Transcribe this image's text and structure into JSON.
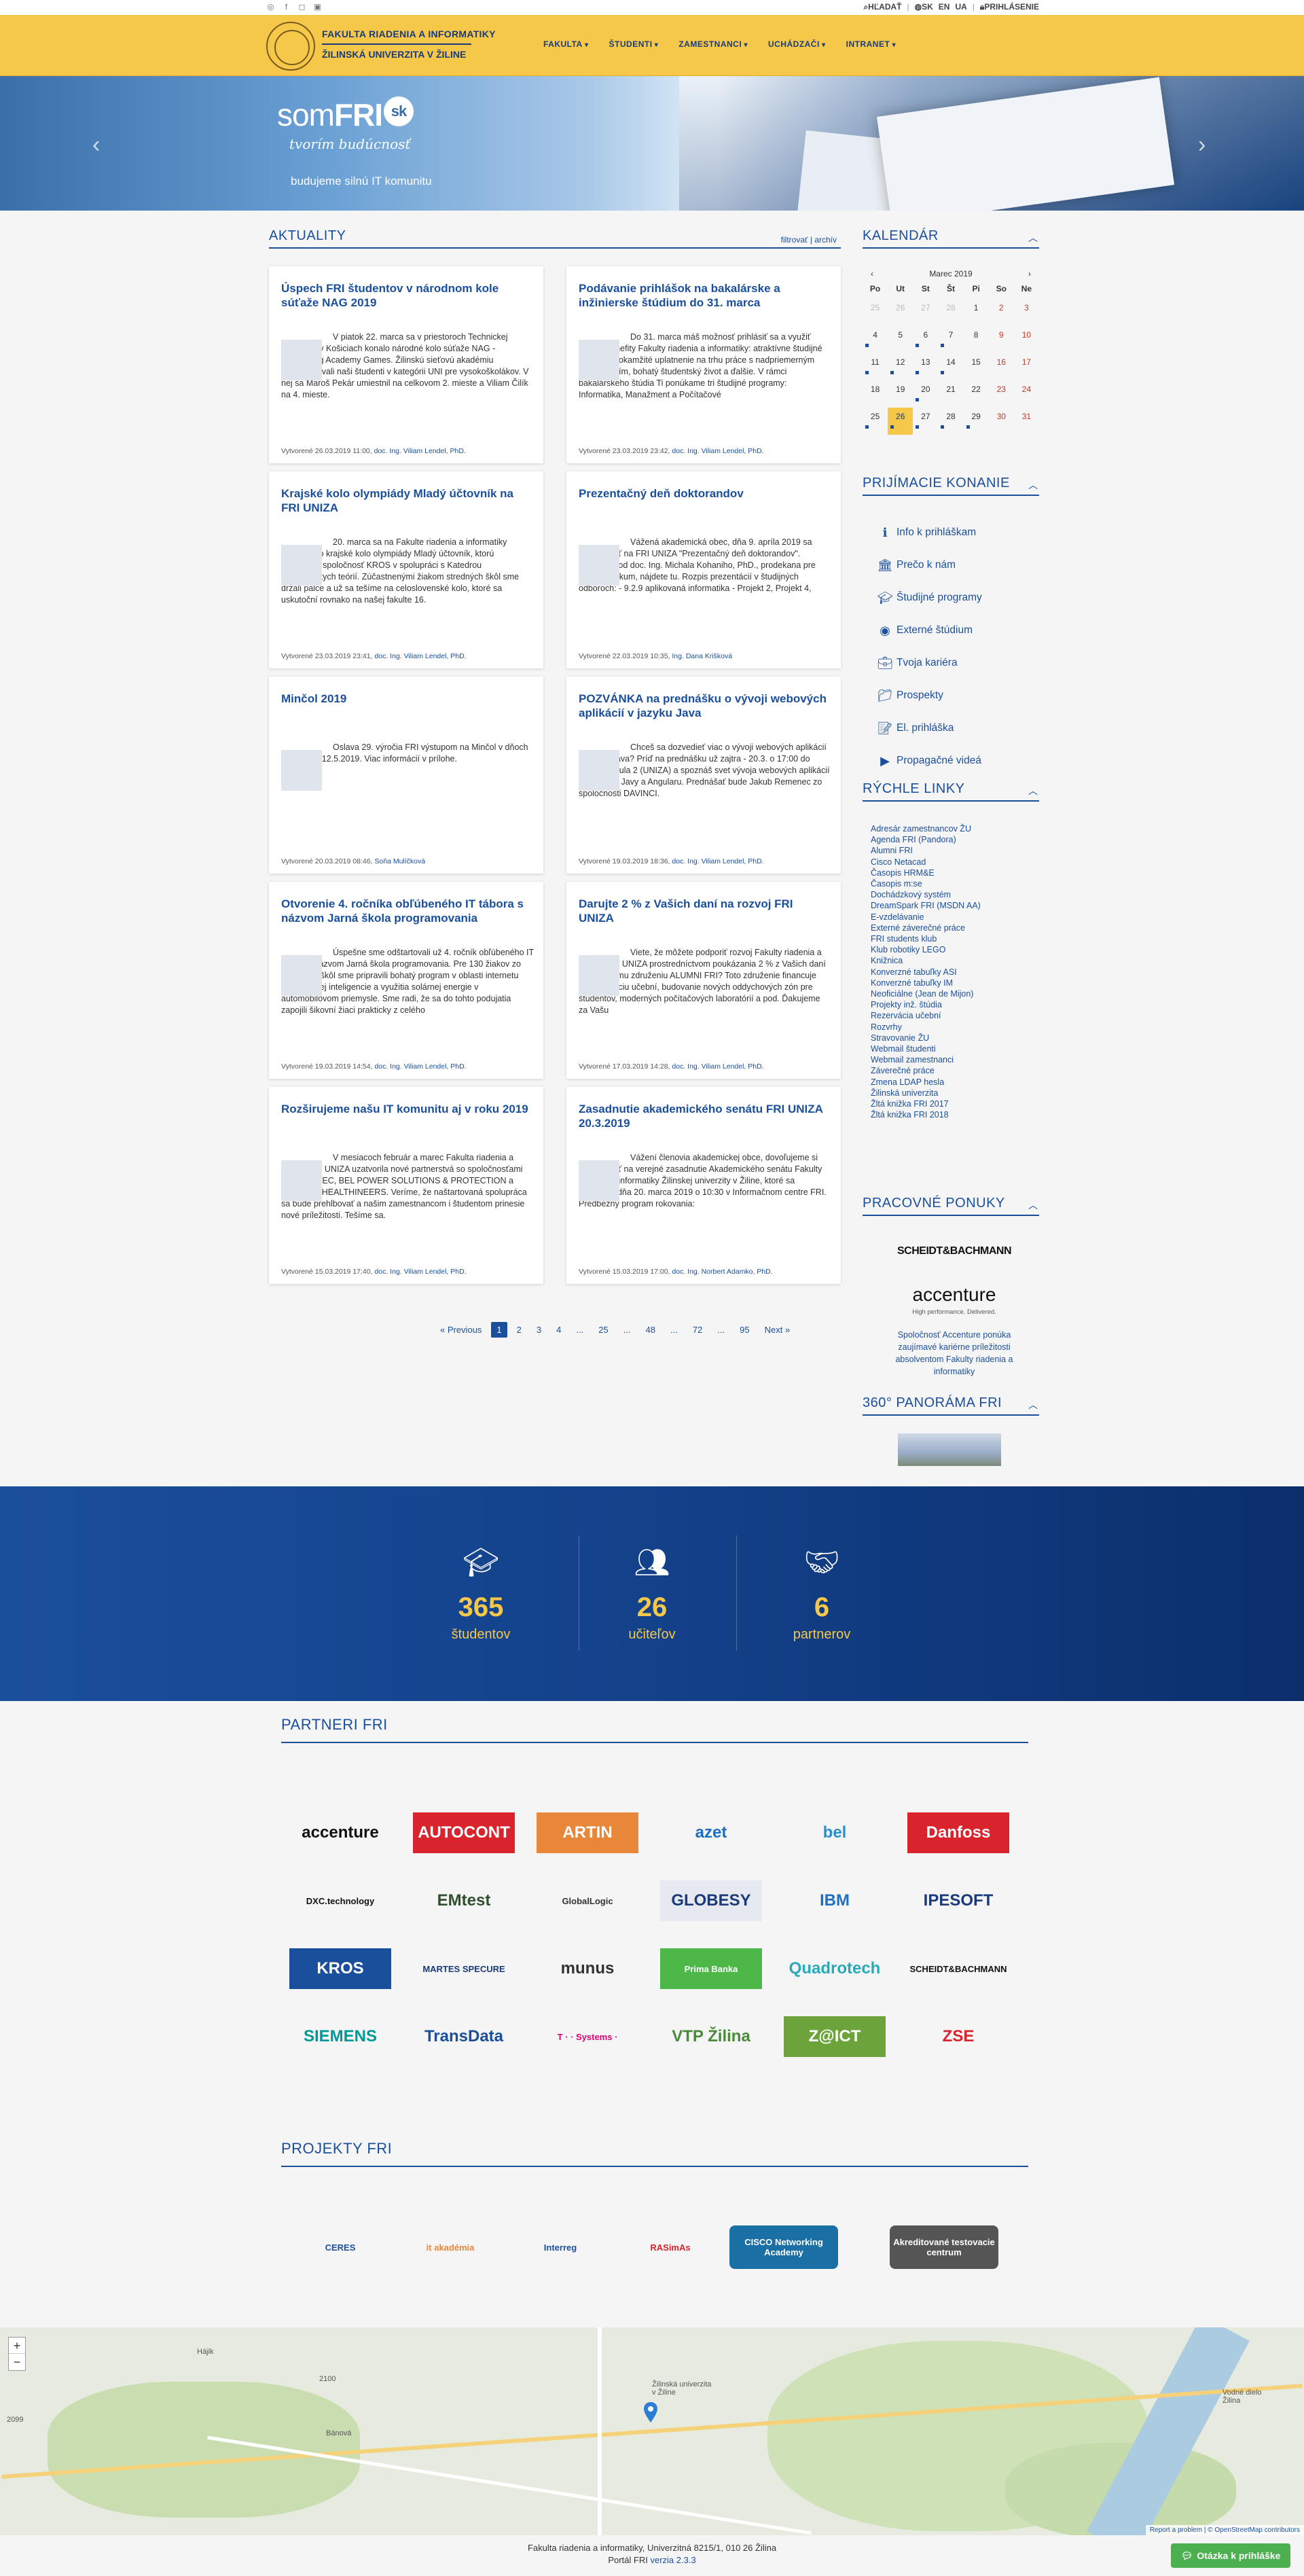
{
  "topbar": {
    "social": [
      "rss-icon",
      "facebook-icon",
      "instagram-icon",
      "gallery-icon"
    ],
    "search_label": "HĽADAŤ",
    "lang_sk": "SK",
    "lang_en": "EN",
    "lang_ua": "UA",
    "login_label": "PRIHLÁSENIE"
  },
  "header": {
    "faculty_name": "FAKULTA RIADENIA A INFORMATIKY",
    "university_name": "ŽILINSKÁ UNIVERZITA V ŽILINE",
    "nav": [
      "FAKULTA",
      "ŠTUDENTI",
      "ZAMESTNANCI",
      "UCHÁDZAČI",
      "INTRANET"
    ]
  },
  "hero": {
    "brand_prefix": "som",
    "brand_main": "FRI",
    "brand_badge": "sk",
    "tagline": "tvorím budúcnosť",
    "claim": "budujeme silnú IT komunitu"
  },
  "news": {
    "title": "AKTUALITY",
    "filter_link": "filtrovať",
    "archive_link": "archív",
    "cards": [
      {
        "title": "Úspech FRI študentov v národnom kole súťaže NAG 2019",
        "body": "V piatok 22. marca sa v priestoroch Technickej univerzity v Košiciach konalo národné kolo súťaže NAG - Networking Academy Games. Žilinskú sieťovú akadémiu reprezentovali naši študenti v kategórii UNI pre vysokoškolákov. V nej sa Maroš Pekár umiestnil na celkovom 2. mieste a Viliam Čilík na 4. mieste.",
        "date": "Vytvorené 26.03.2019 11:00,",
        "author": "doc. Ing. Viliam Lendel, PhD."
      },
      {
        "title": "Podávanie prihlášok na bakalárske a inžinierske štúdium do 31. marca",
        "body": "Do 31. marca máš možnosť prihlásiť sa a využiť hlavné benefity Fakulty riadenia a informatiky: atraktívne študijné programy, okamžité uplatnenie na trhu práce s nadpriemerným ohodnotením, bohatý študentský život a ďalšie. V rámci bakalárskeho štúdia Ti ponúkame tri študijné programy: Informatika, Manažment a Počítačové",
        "date": "Vytvorené 23.03.2019 23:42,",
        "author": "doc. Ing. Viliam Lendel, PhD."
      },
      {
        "title": "Krajské kolo olympiády Mladý účtovník na FRI UNIZA",
        "body": "20. marca sa na Fakulte riadenia a informatiky uskutočnilo krajské kolo olympiády Mladý účtovník, ktorú organizuje spoločnosť KROS v spolupráci s Katedrou manažérskych teórií. Zúčastnenými žiakom stredných škôl sme držali palce a už sa tešíme na celoslovenské kolo, ktoré sa uskutoční rovnako na našej fakulte 16.",
        "date": "Vytvorené 23.03.2019 23:41,",
        "author": "doc. Ing. Viliam Lendel, PhD."
      },
      {
        "title": "Prezentačný deň doktorandov",
        "body": "Vážená akademická obec, dňa 9. apríla 2019 sa bude konať na FRI UNIZA \"Prezentačný deň doktorandov\". Pozvánku od doc. Ing. Michala Kohaniho, PhD., prodekana pre vedu a výskum, nájdete tu. Rozpis prezentácií v študijných odboroch: - 9.2.9 aplikovaná informatika - Projekt 2, Projekt 4,",
        "date": "Vytvorené 22.03.2019 10:35,",
        "author": "Ing. Dana Krišková"
      },
      {
        "title": "Minčol 2019",
        "body": "Oslava 29. výročia FRI výstupom na Minčol v dňoch 8.5.2019 - 12.5.2019. Viac informácií v prílohe.",
        "date": "Vytvorené 20.03.2019 08:46,",
        "author": "Soňa Mulíčková"
      },
      {
        "title": "POZVÁNKA na prednášku o vývoji webových aplikácií v jazyku Java",
        "body": "Chceš sa dozvedieť viac o vývoji webových aplikácií v jazyku Java? Príď na prednášku už zajtra - 20.3. o 17:00 do AF1A2 – Aula 2 (UNIZA) a spoznáš svet vývoja webových aplikácií v prostredí Javy a Angularu. Prednášať bude Jakub Remenec zo spoločnosti DAVINCI.",
        "date": "Vytvorené 19.03.2019 18:36,",
        "author": "doc. Ing. Viliam Lendel, PhD."
      },
      {
        "title": "Otvorenie 4. ročníka obľúbeného IT tábora s názvom Jarná škola programovania",
        "body": "Úspešne sme odštartovali už 4. ročník obľúbeného IT tábora s názvom Jarná škola programovania. Pre 130 žiakov zo stredných škôl sme pripravili bohatý program v oblasti internetu vecí, umelej inteligencie a využitia solárnej energie v automobilovom priemysle. Sme radi, že sa do tohto podujatia zapojili šikovní žiaci prakticky z celého",
        "date": "Vytvorené 19.03.2019 14:54,",
        "author": "doc. Ing. Viliam Lendel, PhD."
      },
      {
        "title": "Darujte 2 % z Vašich daní na rozvoj FRI UNIZA",
        "body": "Viete, že môžete podporiť rozvoj Fakulty riadenia a informatiky UNIZA prostredníctvom poukázania 2 % z Vašich daní občianskemu združeniu ALUMNI FRI? Toto združenie financuje modernizáciu učební, budovanie nových oddychových zón pre študentov, moderných počítačových laboratórií a pod. Ďakujeme za Vašu",
        "date": "Vytvorené 17.03.2019 14:28,",
        "author": "doc. Ing. Viliam Lendel, PhD."
      },
      {
        "title": "Rozširujeme našu IT komunitu aj v roku 2019",
        "body": "V mesiacoch február a marec Fakulta riadenia a informatiky UNIZA uzatvorila nové partnerstvá so spoločnosťami ICZ, SOFTEC, BEL POWER SOLUTIONS & PROTECTION a SIEMENS HEALTHINEERS. Veríme, že naštartovaná spolupráca sa bude prehlbovať a našim zamestnancom i študentom prinesie nové príležitosti. Tešíme sa.",
        "date": "Vytvorené 15.03.2019 17:40,",
        "author": "doc. Ing. Viliam Lendel, PhD."
      },
      {
        "title": "Zasadnutie akademického senátu FRI UNIZA 20.3.2019",
        "body": "Vážení členovia akademickej obce, dovoľujeme si Vás pozvať na verejné zasadnutie Akademického senátu Fakulty riadenia a informatiky Žilinskej univerzity v Žiline, ktoré sa uskutoční dňa 20. marca 2019 o 10:30 v Informačnom centre FRI. Predbežný program rokovania:",
        "date": "Vytvorené 15.03.2019 17:00,",
        "author": "doc. Ing. Norbert Adamko, PhD."
      }
    ]
  },
  "pager": {
    "prev": "« Previous",
    "pages": [
      "1",
      "2",
      "3",
      "4",
      "...",
      "25",
      "...",
      "48",
      "...",
      "72",
      "...",
      "95"
    ],
    "next": "Next »",
    "active": "1"
  },
  "calendar": {
    "title": "KALENDÁR",
    "month": "Marec 2019",
    "weekdays": [
      "Po",
      "Ut",
      "St",
      "Št",
      "Pi",
      "So",
      "Ne"
    ],
    "days": [
      {
        "d": "25",
        "dim": true
      },
      {
        "d": "26",
        "dim": true
      },
      {
        "d": "27",
        "dim": true
      },
      {
        "d": "28",
        "dim": true
      },
      {
        "d": "1"
      },
      {
        "d": "2",
        "we": true
      },
      {
        "d": "3",
        "we": true
      },
      {
        "d": "4",
        "ev": true
      },
      {
        "d": "5"
      },
      {
        "d": "6",
        "ev": true
      },
      {
        "d": "7",
        "ev": true
      },
      {
        "d": "8"
      },
      {
        "d": "9",
        "we": true
      },
      {
        "d": "10",
        "we": true
      },
      {
        "d": "11",
        "ev": true
      },
      {
        "d": "12",
        "ev": true
      },
      {
        "d": "13",
        "ev": true
      },
      {
        "d": "14",
        "ev": true
      },
      {
        "d": "15"
      },
      {
        "d": "16",
        "we": true
      },
      {
        "d": "17",
        "we": true
      },
      {
        "d": "18"
      },
      {
        "d": "19"
      },
      {
        "d": "20",
        "ev": true
      },
      {
        "d": "21"
      },
      {
        "d": "22"
      },
      {
        "d": "23",
        "we": true
      },
      {
        "d": "24",
        "we": true
      },
      {
        "d": "25",
        "ev": true
      },
      {
        "d": "26",
        "today": true,
        "ev": true
      },
      {
        "d": "27",
        "ev": true
      },
      {
        "d": "28",
        "ev": true
      },
      {
        "d": "29",
        "ev": true
      },
      {
        "d": "30",
        "we": true
      },
      {
        "d": "31",
        "we": true
      }
    ]
  },
  "admissions": {
    "title": "PRIJÍMACIE KONANIE",
    "items": [
      {
        "label": "Info k prihláškam",
        "icon": "info-icon"
      },
      {
        "label": "Prečo k nám",
        "icon": "university-icon"
      },
      {
        "label": "Študijné programy",
        "icon": "graduation-cap-icon"
      },
      {
        "label": "Externé štúdium",
        "icon": "globe-icon"
      },
      {
        "label": "Tvoja kariéra",
        "icon": "briefcase-icon"
      },
      {
        "label": "Prospekty",
        "icon": "folder-icon"
      },
      {
        "label": "El. prihláška",
        "icon": "form-icon"
      },
      {
        "label": "Propagačné videá",
        "icon": "video-icon"
      }
    ]
  },
  "quicklinks": {
    "title": "RÝCHLE LINKY",
    "items": [
      "Adresár zamestnancov ŽU",
      "Agenda FRI (Pandora)",
      "Alumni FRI",
      "Cisco Netacad",
      "Časopis HRM&E",
      "Časopis m:se",
      "Dochádzkový systém",
      "DreamSpark FRI (MSDN AA)",
      "E-vzdelávanie",
      "Externé záverečné práce",
      "FRI students klub",
      "Klub robotiky LEGO",
      "Knižnica",
      "Konverzné tabuľky ASI",
      "Konverzné tabuľky IM",
      "Neoficiálne (Jean de Mijon)",
      "Projekty inž. štúdia",
      "Rezervácia učební",
      "Rozvrhy",
      "Stravovanie ŽU",
      "Webmail študenti",
      "Webmail zamestnanci",
      "Záverečné práce",
      "Zmena LDAP hesla",
      "Žilinská univerzita",
      "Žltá knižka FRI 2017",
      "Žltá knižka FRI 2018"
    ]
  },
  "jobs": {
    "title": "PRACOVNÉ PONUKY",
    "logo1": "SCHEIDT&BACHMANN",
    "logo2": "accenture",
    "logo2_sub": "High performance. Delivered.",
    "text": "Spoločnosť Accenture ponúka zaujímavé kariérne príležitosti absolventom Fakulty riadenia a informatiky"
  },
  "panorama": {
    "title": "360° PANORÁMA FRI"
  },
  "stats": [
    {
      "num": "365",
      "label": "študentov",
      "icon": "graduation-cap-icon"
    },
    {
      "num": "26",
      "label": "učiteľov",
      "icon": "users-icon"
    },
    {
      "num": "6",
      "label": "partnerov",
      "icon": "handshake-icon"
    }
  ],
  "partners": {
    "title": "PARTNERI FRI",
    "logos": [
      {
        "name": "accenture",
        "color": "#111",
        "bg": "transparent"
      },
      {
        "name": "AUTOCONT",
        "color": "#fff",
        "bg": "#d9232d"
      },
      {
        "name": "ARTIN",
        "color": "#fff",
        "bg": "#e8873a"
      },
      {
        "name": "azet",
        "color": "#1a6fc4",
        "bg": "transparent"
      },
      {
        "name": "bel",
        "color": "#2a8fd0",
        "bg": "transparent"
      },
      {
        "name": "Danfoss",
        "color": "#fff",
        "bg": "#d9232d"
      },
      {
        "name": "DXC.technology",
        "color": "#111",
        "bg": "transparent"
      },
      {
        "name": "EMtest",
        "color": "#2f4f2f",
        "bg": "transparent"
      },
      {
        "name": "GlobalLogic",
        "color": "#333",
        "bg": "transparent"
      },
      {
        "name": "GLOBESY",
        "color": "#1a3a7a",
        "bg": "#e6eaf0"
      },
      {
        "name": "IBM",
        "color": "#1f70c1",
        "bg": "transparent"
      },
      {
        "name": "IPESOFT",
        "color": "#1a3a7a",
        "bg": "transparent"
      },
      {
        "name": "KROS",
        "color": "#fff",
        "bg": "#1a4f9c"
      },
      {
        "name": "MARTES SPECURE",
        "color": "#1a3a7a",
        "bg": "transparent"
      },
      {
        "name": "munus",
        "color": "#333",
        "bg": "transparent"
      },
      {
        "name": "Prima Banka",
        "color": "#fff",
        "bg": "#4db848"
      },
      {
        "name": "Quadrotech",
        "color": "#2aa9b8",
        "bg": "transparent"
      },
      {
        "name": "SCHEIDT&BACHMANN",
        "color": "#111",
        "bg": "transparent"
      },
      {
        "name": "SIEMENS",
        "color": "#009999",
        "bg": "transparent"
      },
      {
        "name": "TransData",
        "color": "#1a4f9c",
        "bg": "transparent"
      },
      {
        "name": "T · · Systems ·",
        "color": "#e20074",
        "bg": "transparent"
      },
      {
        "name": "VTP Žilina",
        "color": "#4a8a3a",
        "bg": "transparent"
      },
      {
        "name": "Z@ICT",
        "color": "#fff",
        "bg": "#6ca33a"
      },
      {
        "name": "ZSE",
        "color": "#d9232d",
        "bg": "transparent"
      }
    ]
  },
  "projects": {
    "title": "PROJEKTY FRI",
    "logos": [
      {
        "name": "CERES",
        "color": "#1a4f9c",
        "bg": "transparent"
      },
      {
        "name": "it akadémia",
        "color": "#e8873a",
        "bg": "transparent"
      },
      {
        "name": "Interreg",
        "color": "#1a4f9c",
        "bg": "transparent"
      },
      {
        "name": "RASimAs",
        "color": "#d9232d",
        "bg": "transparent"
      },
      {
        "name": "CISCO Networking Academy",
        "color": "#fff",
        "bg": "#1a6fa4"
      },
      {
        "name": "Akreditované testovacie centrum",
        "color": "#fff",
        "bg": "#555"
      }
    ]
  },
  "map": {
    "zoom_in": "+",
    "zoom_out": "−",
    "labels": [
      "Žilinská univerzita v Žiline",
      "Bánová",
      "Vodné dielo Žilina",
      "Hájik",
      "2100",
      "2099"
    ],
    "attribution": "Report a problem | © OpenStreetMap contributors"
  },
  "footer": {
    "address": "Fakulta riadenia a informatiky, Univerzitná 8215/1, 010 26 Žilina",
    "portal_prefix": "Portál FRI",
    "version": "verzia 2.3.3",
    "ask_button": "Otázka k prihláške"
  }
}
